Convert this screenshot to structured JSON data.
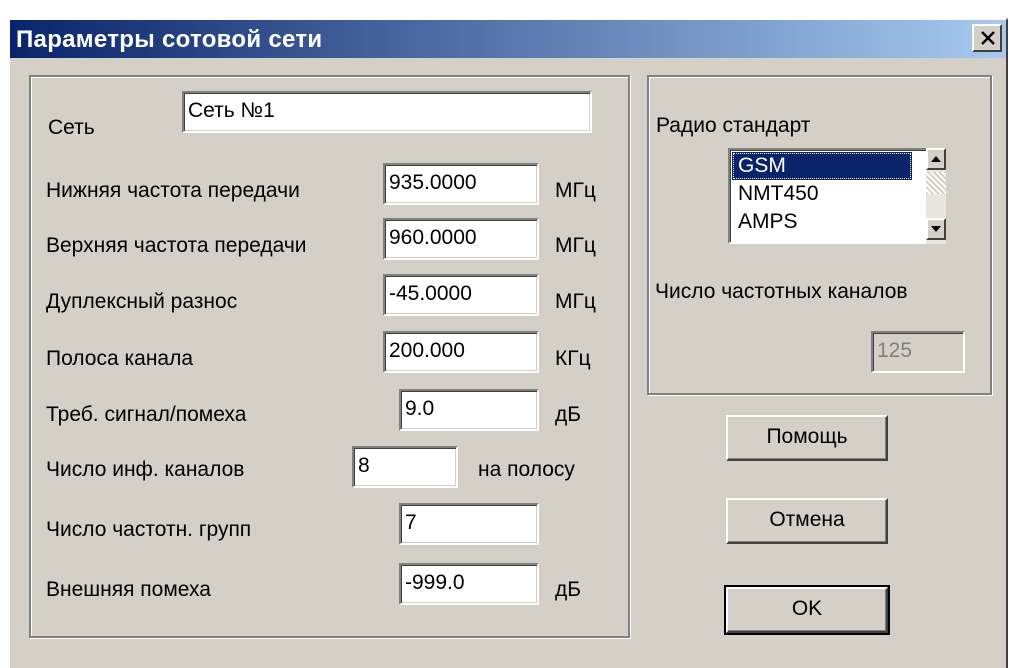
{
  "window": {
    "title": "Параметры сотовой сети"
  },
  "network": {
    "label": "Сеть",
    "value": "Сеть №1"
  },
  "params": {
    "tx_low": {
      "label": "Нижняя частота передачи",
      "value": "935.0000",
      "unit": "МГц"
    },
    "tx_high": {
      "label": "Верхняя частота передачи",
      "value": "960.0000",
      "unit": "МГц"
    },
    "duplex": {
      "label": "Дуплексный разнос",
      "value": "-45.0000",
      "unit": "МГц"
    },
    "channel_bw": {
      "label": "Полоса канала",
      "value": "200.000",
      "unit": "КГц"
    },
    "snr": {
      "label": "Треб. сигнал/помеха",
      "value": "9.0",
      "unit": "дБ"
    },
    "info_channels": {
      "label": "Число инф. каналов",
      "value": "8",
      "unit": "на полосу"
    },
    "freq_groups": {
      "label": "Число частотн. групп",
      "value": "7"
    },
    "ext_noise": {
      "label": "Внешняя помеха",
      "value": "-999.0",
      "unit": "дБ"
    }
  },
  "radio": {
    "label": "Радио стандарт",
    "options": [
      "GSM",
      "NMT450",
      "AMPS"
    ],
    "selected": "GSM",
    "channels_label": "Число частотных каналов",
    "channels_value": "125"
  },
  "buttons": {
    "help": "Помощь",
    "cancel": "Отмена",
    "ok": "OK"
  },
  "colors": {
    "title_bar_start": "#0a246a",
    "title_bar_end": "#a6caf0",
    "face": "#d4d0c8",
    "selection": "#0a246a"
  }
}
